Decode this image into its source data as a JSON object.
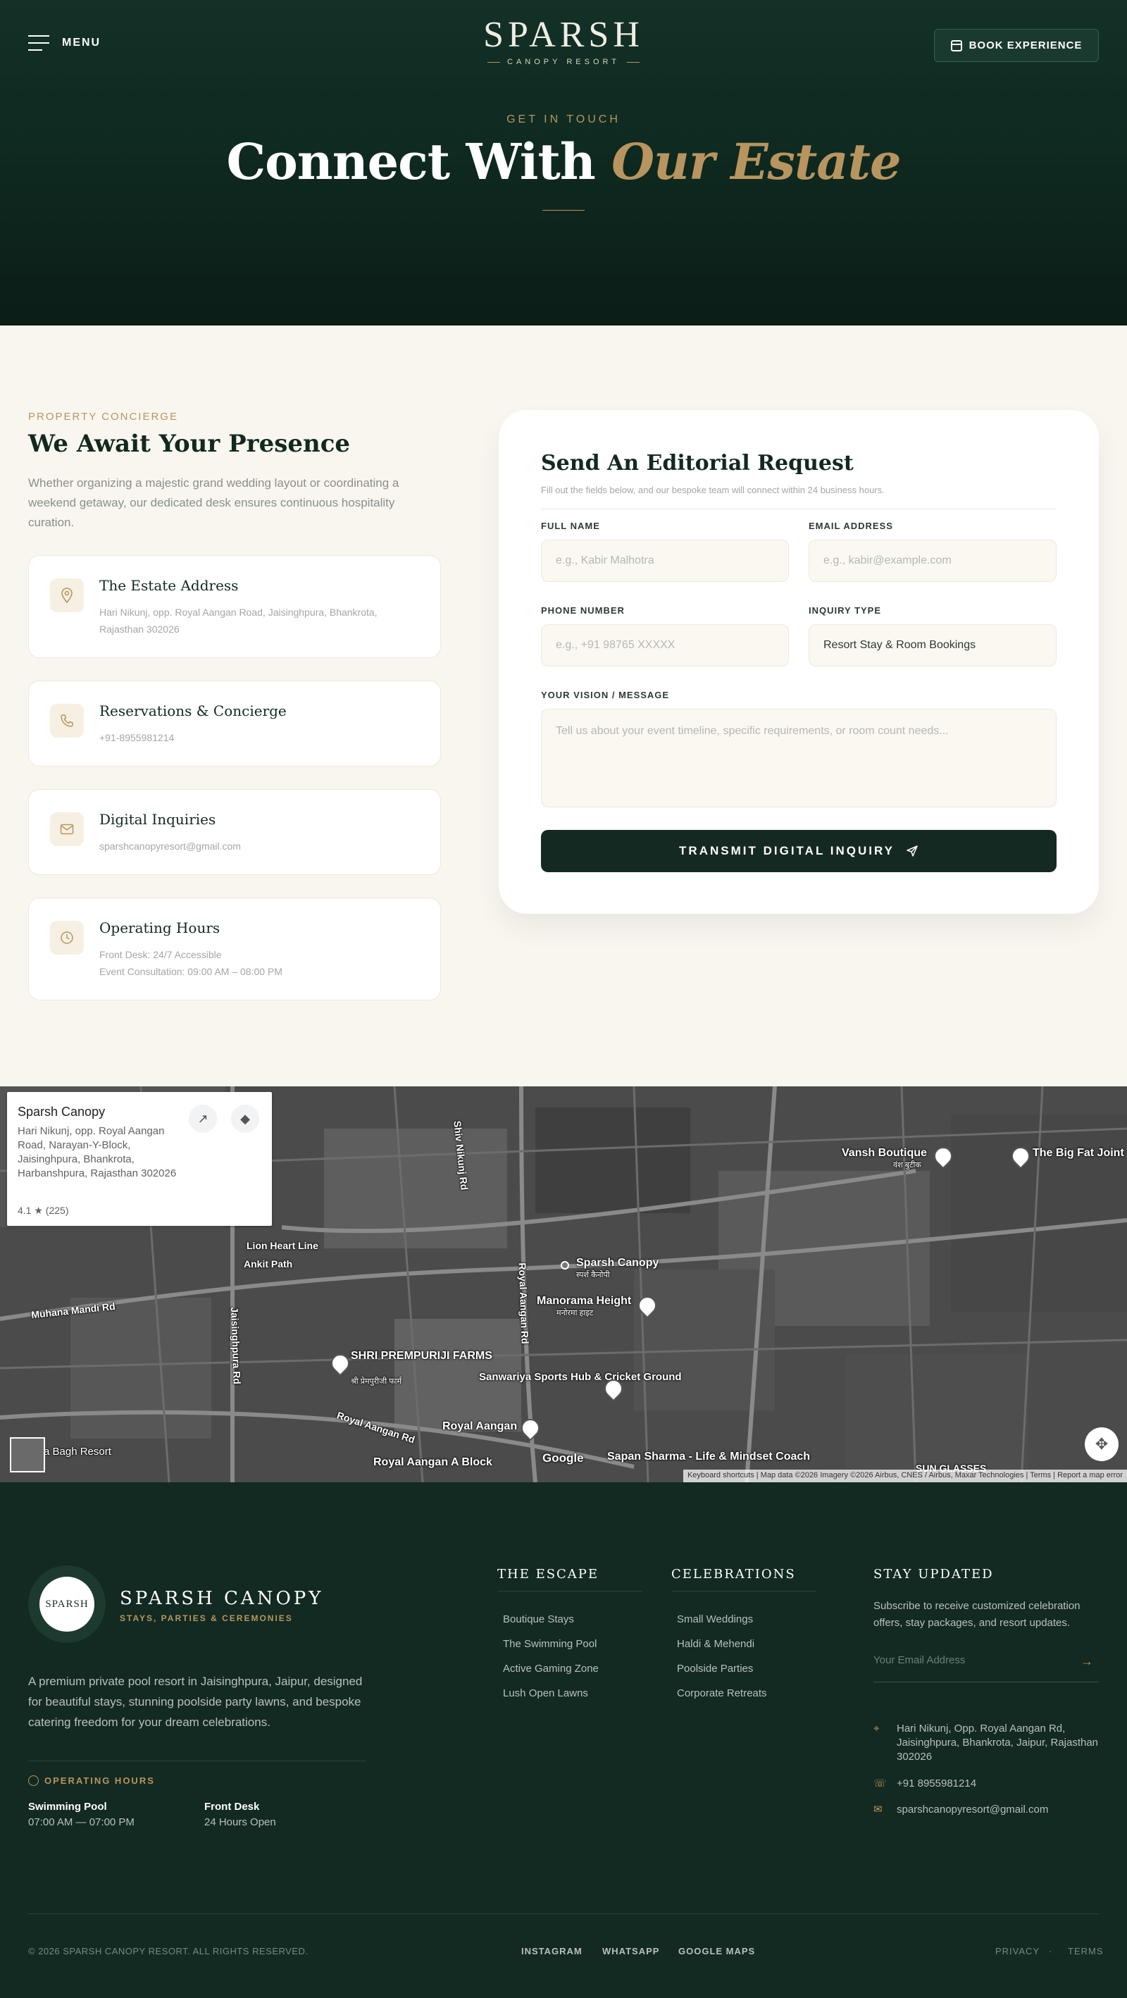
{
  "header": {
    "menu_label": "MENU",
    "logo_word": "SPARSH",
    "logo_sub": "CANOPY RESORT",
    "book_label": "BOOK EXPERIENCE"
  },
  "hero": {
    "eyebrow": "GET IN TOUCH",
    "title_main": "Connect With ",
    "title_accent": "Our Estate"
  },
  "concierge": {
    "eyebrow": "PROPERTY CONCIERGE",
    "title": "We Await Your Presence",
    "description": "Whether organizing a majestic grand wedding layout or coordinating a weekend getaway, our dedicated desk ensures continuous hospitality curation.",
    "cards": [
      {
        "title": "The Estate Address",
        "lines": [
          "Hari Nikunj, opp. Royal Aangan Road, Jaisinghpura, Bhankrota,",
          "Rajasthan 302026"
        ]
      },
      {
        "title": "Reservations & Concierge",
        "lines": [
          "+91-8955981214"
        ]
      },
      {
        "title": "Digital Inquiries",
        "lines": [
          "sparshcanopyresort@gmail.com"
        ]
      },
      {
        "title": "Operating Hours",
        "lines": [
          "Front Desk: 24/7 Accessible",
          "Event Consultation: 09:00 AM – 08:00 PM"
        ]
      }
    ]
  },
  "form": {
    "title": "Send An Editorial Request",
    "subtitle": "Fill out the fields below, and our bespoke team will connect within 24 business hours.",
    "full_name_label": "FULL NAME",
    "full_name_placeholder": "e.g., Kabir Malhotra",
    "email_label": "EMAIL ADDRESS",
    "email_placeholder": "e.g., kabir@example.com",
    "phone_label": "PHONE NUMBER",
    "phone_placeholder": "e.g., +91 98765 XXXXX",
    "inquiry_label": "INQUIRY TYPE",
    "inquiry_value": "Resort Stay & Room Bookings",
    "message_label": "YOUR VISION / MESSAGE",
    "message_placeholder": "Tell us about your event timeline, specific requirements, or room count needs...",
    "submit_label": "TRANSMIT DIGITAL INQUIRY"
  },
  "map": {
    "place_name": "Sparsh Canopy",
    "place_address": "Hari Nikunj, opp. Royal Aangan Road, Narayan-Y-Block, Jaisinghpura, Bhankrota, Harbanshpura, Rajasthan 302026",
    "rating": "4.1 ★ (225)",
    "labels": {
      "sparsh": "Sparsh Canopy",
      "sparsh_hi": "स्पर्श कैनोपी",
      "manorama": "Manorama Height",
      "manorama_hi": "मनोरमा हाइट",
      "shri": "SHRI PREMPURIJI FARMS",
      "shri_hi": "श्री प्रेमपुरीजी फार्म",
      "sanwariya": "Sanwariya Sports Hub & Cricket Ground",
      "royal_aangan": "Royal Aangan",
      "royal_aangan_a": "Royal Aangan A Block",
      "sapan": "Sapan Sharma - Life & Mindset Coach",
      "vansh": "Vansh Boutique",
      "vansh_hi": "वंश बुटीक",
      "bigfat": "The Big Fat Joint",
      "lion": "Lion Heart Line",
      "ankit": "Ankit Path",
      "muhana": "Muhana Mandi Rd",
      "shiv": "Shiv Nikunj Rd",
      "royal_rd": "Royal Aangan Rd",
      "royal_rd2": "Royal Aangan Rd",
      "jaisinghpura": "Jaisinghpura Rd",
      "bagh": "a Bagh Resort",
      "sun": "SUN GLASSES",
      "google": "Google"
    },
    "attribution": "Keyboard shortcuts  |  Map data ©2026 Imagery ©2026 Airbus, CNES / Airbus, Maxar Technologies  |  Terms  |  Report a map error"
  },
  "footer": {
    "badge_text": "SPARSH",
    "brand": "SPARSH CANOPY",
    "tagline": "STAYS, PARTIES & CEREMONIES",
    "description": "A premium private pool resort in Jaisinghpura, Jaipur, designed for beautiful stays, stunning poolside party lawns, and bespoke catering freedom for your dream celebrations.",
    "hours_heading": "OPERATING HOURS",
    "hours": [
      {
        "name": "Swimming Pool",
        "value": "07:00 AM — 07:00 PM"
      },
      {
        "name": "Front Desk",
        "value": "24 Hours Open"
      }
    ],
    "escape_heading": "THE ESCAPE",
    "escape_links": [
      "Boutique Stays",
      "The Swimming Pool",
      "Active Gaming Zone",
      "Lush Open Lawns"
    ],
    "celebrations_heading": "CELEBRATIONS",
    "celebrations_links": [
      "Small Weddings",
      "Haldi & Mehendi",
      "Poolside Parties",
      "Corporate Retreats"
    ],
    "news_heading": "STAY UPDATED",
    "news_description": "Subscribe to receive customized celebration offers, stay packages, and resort updates.",
    "email_placeholder": "Your Email Address",
    "contact_address": "Hari Nikunj, Opp. Royal Aangan Rd, Jaisinghpura, Bhankrota, Jaipur, Rajasthan 302026",
    "contact_phone": "+91 8955981214",
    "contact_email": "sparshcanopyresort@gmail.com",
    "copyright": "© 2026 SPARSH CANOPY RESORT. ALL RIGHTS RESERVED.",
    "social": [
      "INSTAGRAM",
      "WHATSAPP",
      "GOOGLE MAPS"
    ],
    "legal": [
      "PRIVACY",
      "·",
      "TERMS"
    ]
  },
  "colors": {
    "brand_dark": "#122a21",
    "accent_gold": "#b8955f",
    "background": "#f8f6ef"
  }
}
